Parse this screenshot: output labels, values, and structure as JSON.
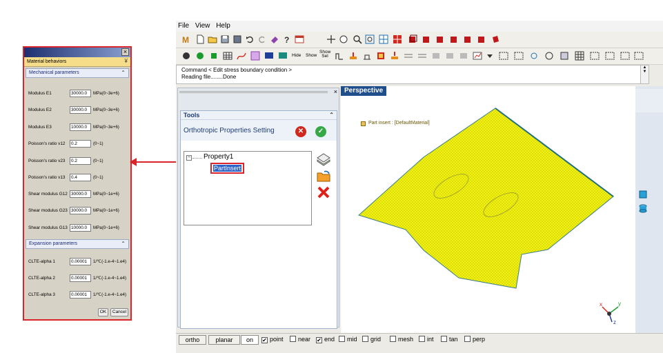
{
  "dialog": {
    "close": "×",
    "material_behaviors": "Material behaviors",
    "mechanical_header": "Mechanical parameters",
    "mechanical": [
      {
        "label": "Modulus E1",
        "value": "30000.0",
        "unit": "MPa(0~3e+6)"
      },
      {
        "label": "Modulus E2",
        "value": "30000.0",
        "unit": "MPa(0~3e+6)"
      },
      {
        "label": "Modulus E3",
        "value": "10000.0",
        "unit": "MPa(0~3e+6)"
      },
      {
        "label": "Poisson's ratio v12",
        "value": "0.2",
        "unit": "(0~1)"
      },
      {
        "label": "Poisson's ratio v23",
        "value": "0.2",
        "unit": "(0~1)"
      },
      {
        "label": "Poisson's ratio v13",
        "value": "0.4",
        "unit": "(0~1)"
      },
      {
        "label": "Shear modulus G12",
        "value": "30000.0",
        "unit": "MPa(0~1e+6)"
      },
      {
        "label": "Shear modulus G23",
        "value": "30000.0",
        "unit": "MPa(0~1e+6)"
      },
      {
        "label": "Shear modulus G13",
        "value": "10000.0",
        "unit": "MPa(0~1e+6)"
      }
    ],
    "expansion_header": "Expansion parameters",
    "expansion": [
      {
        "label": "CLTE-alpha 1",
        "value": "0.00001",
        "unit": "1/℃(-1.e-4~1.e4)"
      },
      {
        "label": "CLTE-alpha 2",
        "value": "0.00001",
        "unit": "1/℃(-1.e-4~1.e4)"
      },
      {
        "label": "CLTE-alpha 3",
        "value": "0.00001",
        "unit": "1/℃(-1.e-4~1.e4)"
      }
    ],
    "ok": "OK",
    "cancel": "Cancel"
  },
  "app": {
    "menu": [
      "File",
      "View",
      "Help"
    ],
    "toolbar": {
      "hide": "Hide",
      "show": "Show",
      "show_sel": "Show Sel"
    },
    "command": {
      "line1": "Command < Edit stress boundary condition >",
      "line2": "Reading file........Done"
    },
    "tools": {
      "title": "Tools",
      "panel_title": "Orthotropic Properties Setting",
      "tree_root": "Property1",
      "tree_child": "PartInsert"
    },
    "viewport": {
      "title": "Perspective",
      "legend": "Part insert : [DefaultMaterial]",
      "axes": {
        "x": "x",
        "y": "y",
        "z": "z"
      }
    },
    "statusbar": {
      "buttons": [
        "ortho",
        "planar",
        "on"
      ],
      "snaps": [
        {
          "label": "point",
          "checked": true
        },
        {
          "label": "near",
          "checked": false
        },
        {
          "label": "end",
          "checked": true
        },
        {
          "label": "mid",
          "checked": false
        },
        {
          "label": "grid",
          "checked": false
        },
        {
          "label": "mesh",
          "checked": false
        },
        {
          "label": "int",
          "checked": false
        },
        {
          "label": "tan",
          "checked": false
        },
        {
          "label": "perp",
          "checked": false
        }
      ]
    }
  },
  "colors": {
    "highlight_red": "#d9242b",
    "mesh_yellow": "#f2f20a",
    "title_blue": "#1f4e8c"
  }
}
